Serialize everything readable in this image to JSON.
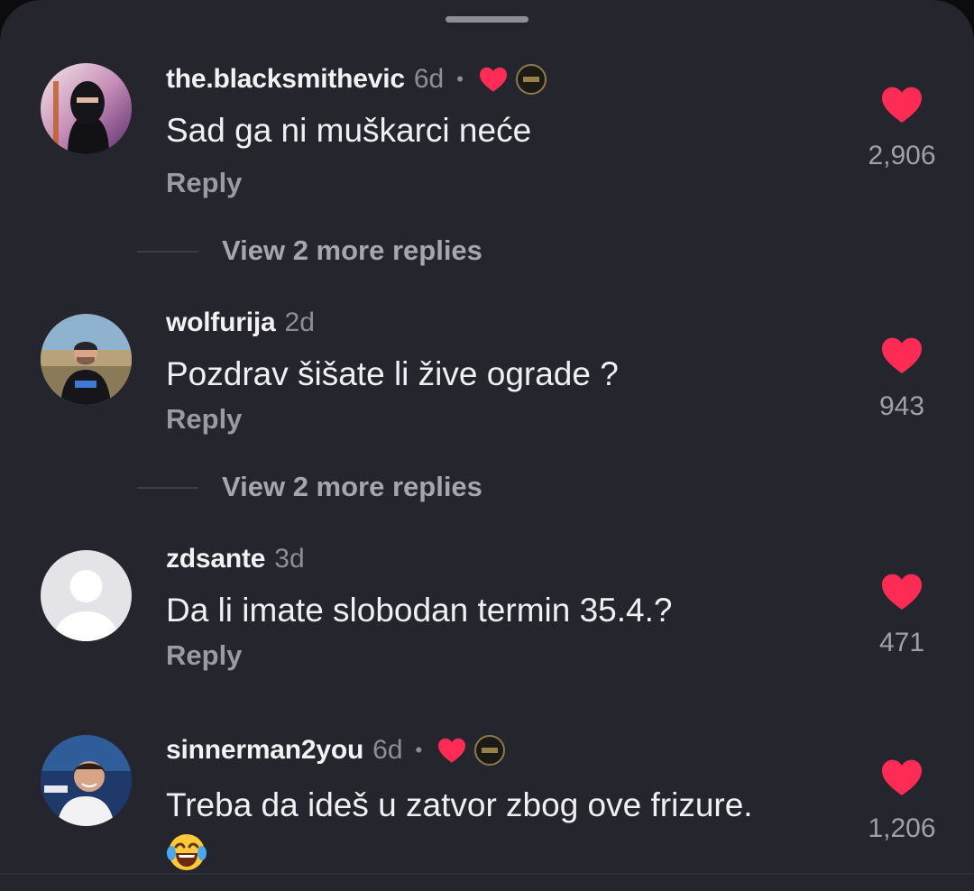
{
  "comments": [
    {
      "username": "the.blacksmithevic",
      "time": "6d",
      "separator": "•",
      "text": "Sad ga ni muškarci neće",
      "reply_label": "Reply",
      "likes": "2,906",
      "liked_by_creator": true,
      "view_more": "View 2 more replies"
    },
    {
      "username": "wolfurija",
      "time": "2d",
      "text": "Pozdrav šišate li žive ograde ?",
      "reply_label": "Reply",
      "likes": "943",
      "liked_by_creator": false,
      "view_more": "View 2 more replies"
    },
    {
      "username": "zdsante",
      "time": "3d",
      "text": "Da li imate slobodan termin 35.4.?",
      "reply_label": "Reply",
      "likes": "471",
      "liked_by_creator": false
    },
    {
      "username": "sinnerman2you",
      "time": "6d",
      "separator": "•",
      "text": "Treba da ideš u zatvor zbog ove frizure.",
      "emoji": "😂",
      "likes": "1,206",
      "liked_by_creator": true
    }
  ],
  "colors": {
    "background": "#25252d",
    "heart": "#fe2c55",
    "username": "#f2f2f4",
    "secondary_text": "#8e8e96"
  },
  "icons": {
    "like": "heart-icon",
    "creator_like": "creator-heart-icon",
    "default_avatar": "default-avatar-icon",
    "emoji": "laughing-tears-emoji"
  }
}
